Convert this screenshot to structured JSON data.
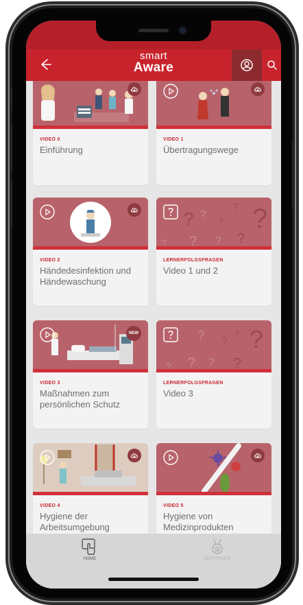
{
  "header": {
    "logo_small": "smart",
    "logo_big": "Aware",
    "back_icon": "arrow-left-icon",
    "user_icon": "user-circle-icon",
    "search_icon": "search-icon"
  },
  "colors": {
    "brand_red": "#c8232c",
    "status_red": "#b51f29",
    "thumb_rose": "#b8636b",
    "card_bg": "#f3f3f3"
  },
  "cards": [
    {
      "kicker": "VIDEO 0",
      "title": "Einführung",
      "icon": "cloud-download-icon",
      "type": "video"
    },
    {
      "kicker": "VIDEO 1",
      "title": "Übertragungswege",
      "icon": "cloud-download-icon",
      "type": "video"
    },
    {
      "kicker": "VIDEO 2",
      "title": "Händedesinfektion und Händewaschung",
      "icon": "cloud-download-icon",
      "type": "video"
    },
    {
      "kicker": "LERNERFOLGSFRAGEN",
      "title": "Video 1 und 2",
      "icon": "question-icon",
      "type": "quiz"
    },
    {
      "kicker": "VIDEO 3",
      "title": "Maßnahmen zum persönlichen Schutz",
      "badge": "NEW",
      "type": "video"
    },
    {
      "kicker": "LERNERFOLGSFRAGEN",
      "title": "Video 3",
      "icon": "question-icon",
      "type": "quiz"
    },
    {
      "kicker": "VIDEO 4",
      "title": "Hygiene der Arbeitsumgebung",
      "icon": "cloud-download-icon",
      "type": "video"
    },
    {
      "kicker": "VIDEO 5",
      "title": "Hygiene von Medizinprodukten",
      "icon": "cloud-download-icon",
      "type": "video"
    }
  ],
  "tabs": [
    {
      "label": "HOME",
      "icon": "hand-tap-icon",
      "active": true
    },
    {
      "label": "ZERTIFIKATE",
      "icon": "medal-icon",
      "active": false
    }
  ]
}
